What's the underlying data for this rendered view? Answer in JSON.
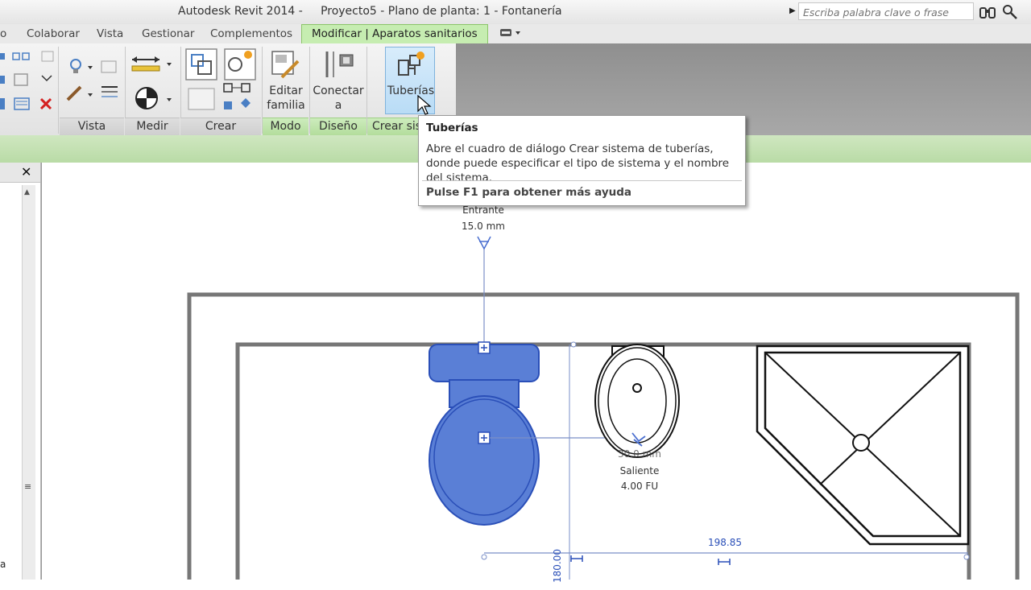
{
  "window": {
    "title": "Autodesk Revit 2014 -     Proyecto5 - Plano de planta: 1 - Fontanería",
    "search_placeholder": "Escriba palabra clave o frase"
  },
  "tabs": [
    {
      "label": "o"
    },
    {
      "label": "Colaborar"
    },
    {
      "label": "Vista"
    },
    {
      "label": "Gestionar"
    },
    {
      "label": "Complementos"
    },
    {
      "label": "Modificar | Aparatos sanitarios",
      "active": true
    }
  ],
  "ribbon": {
    "panels": {
      "vista": "Vista",
      "medir": "Medir",
      "crear": "Crear",
      "modo": "Modo",
      "diseno": "Diseño",
      "crear_sistemas": "Crear sist"
    },
    "buttons": {
      "editar_familia": "Editar\nfamilia",
      "conectar_a": "Conectar\na",
      "tuberias": "Tuberías"
    }
  },
  "tooltip": {
    "title": "Tuberías",
    "body": "Abre el cuadro de diálogo Crear sistema de tuberías, donde puede especificar el tipo de sistema y el nombre del sistema.",
    "help": "Pulse F1 para obtener más ayuda"
  },
  "left_panel": {
    "partial_text": "a"
  },
  "drawing": {
    "connector_top_label": "Entrante",
    "connector_top_size": "15.0 mm",
    "sink_size_partial": "30.0 mm",
    "sink_flow_label": "Saliente",
    "sink_units": "4.00 FU",
    "dimension_horizontal": "198.85",
    "dimension_vertical": "180.00",
    "colors": {
      "selected_fixture": "#5a7fd6",
      "selected_outline": "#2a4fb8",
      "wall": "#777777"
    }
  }
}
